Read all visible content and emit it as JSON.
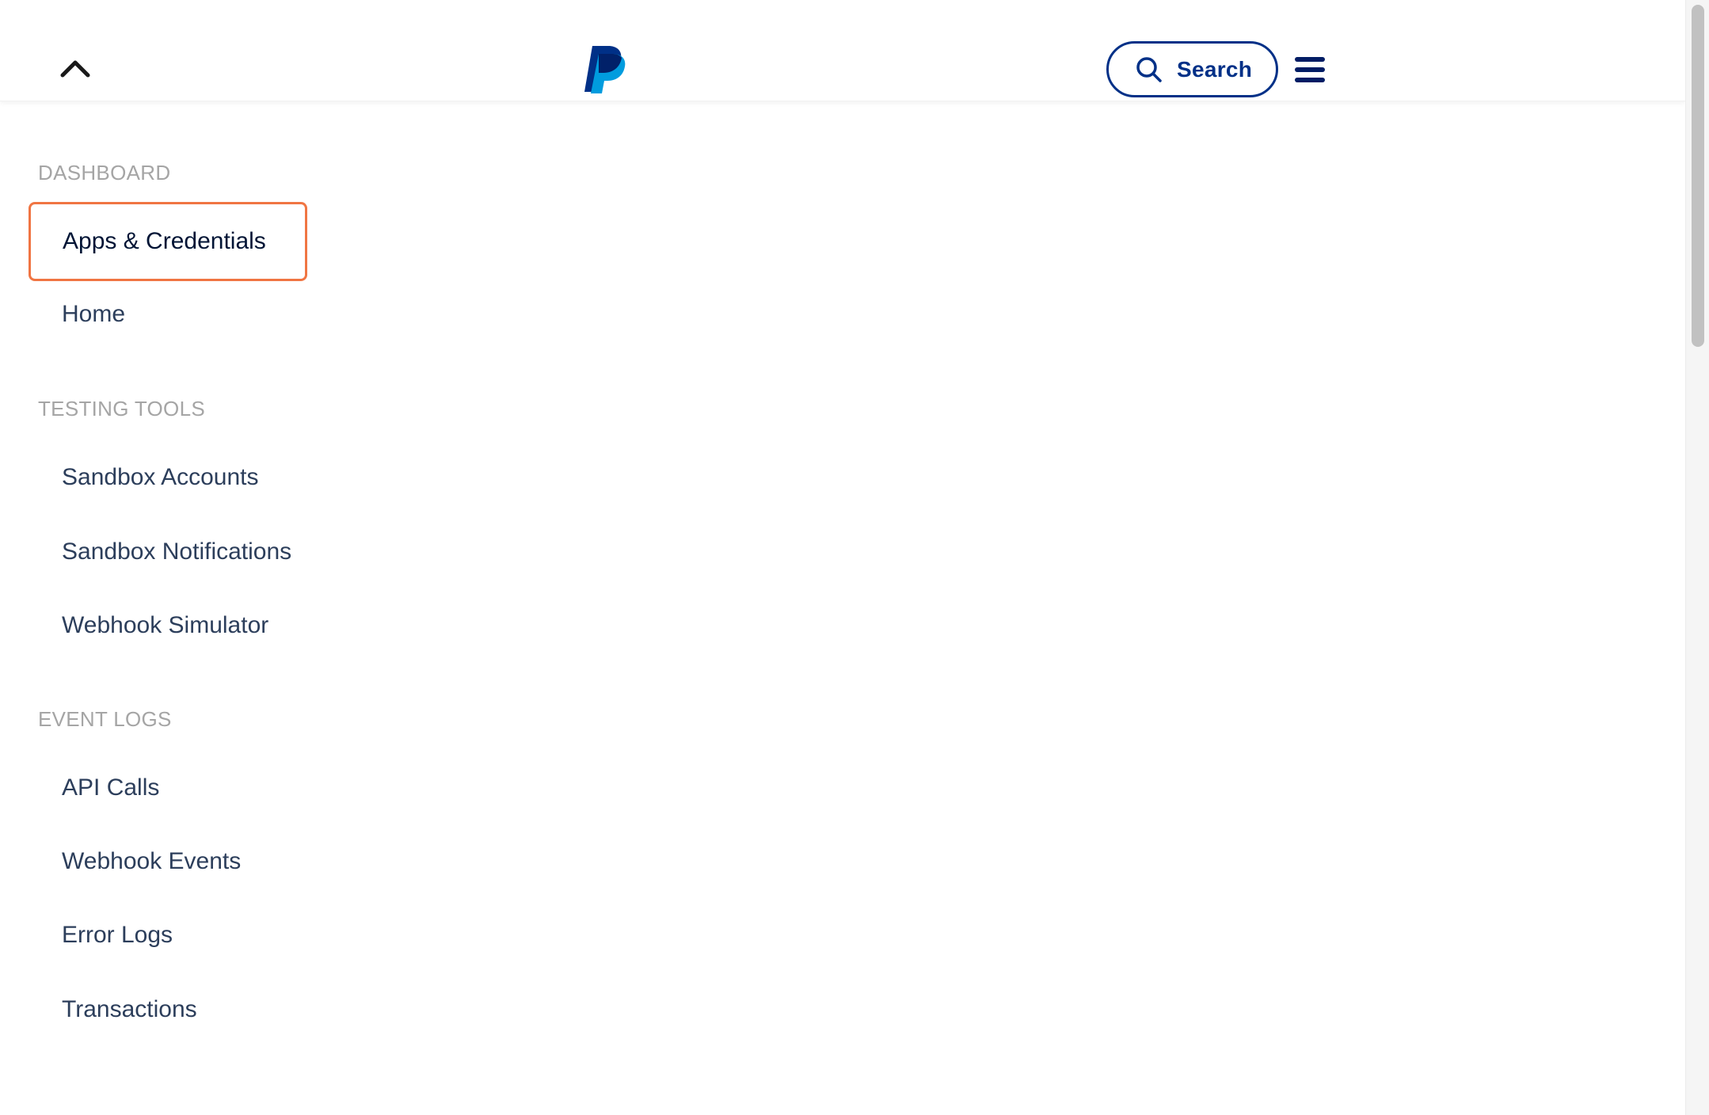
{
  "header": {
    "collapse_icon": "chevron-up-icon",
    "logo": "paypal-logo",
    "search_label": "Search",
    "search_icon": "search-icon",
    "menu_icon": "hamburger-menu-icon"
  },
  "sidebar": {
    "sections": [
      {
        "title": "DASHBOARD",
        "items": [
          "Apps & Credentials",
          "Home"
        ]
      },
      {
        "title": "TESTING TOOLS",
        "items": [
          "Sandbox Accounts",
          "Sandbox Notifications",
          "Webhook Simulator"
        ]
      },
      {
        "title": "EVENT LOGS",
        "items": [
          "API Calls",
          "Webhook Events",
          "Error Logs",
          "Transactions"
        ]
      }
    ],
    "active_item": "Apps & Credentials"
  },
  "colors": {
    "brand_dark": "#003087",
    "brand_light": "#009cde",
    "active_outline": "#f07543",
    "section_title": "#a5a5a5",
    "nav_text": "#2c3e5b"
  }
}
